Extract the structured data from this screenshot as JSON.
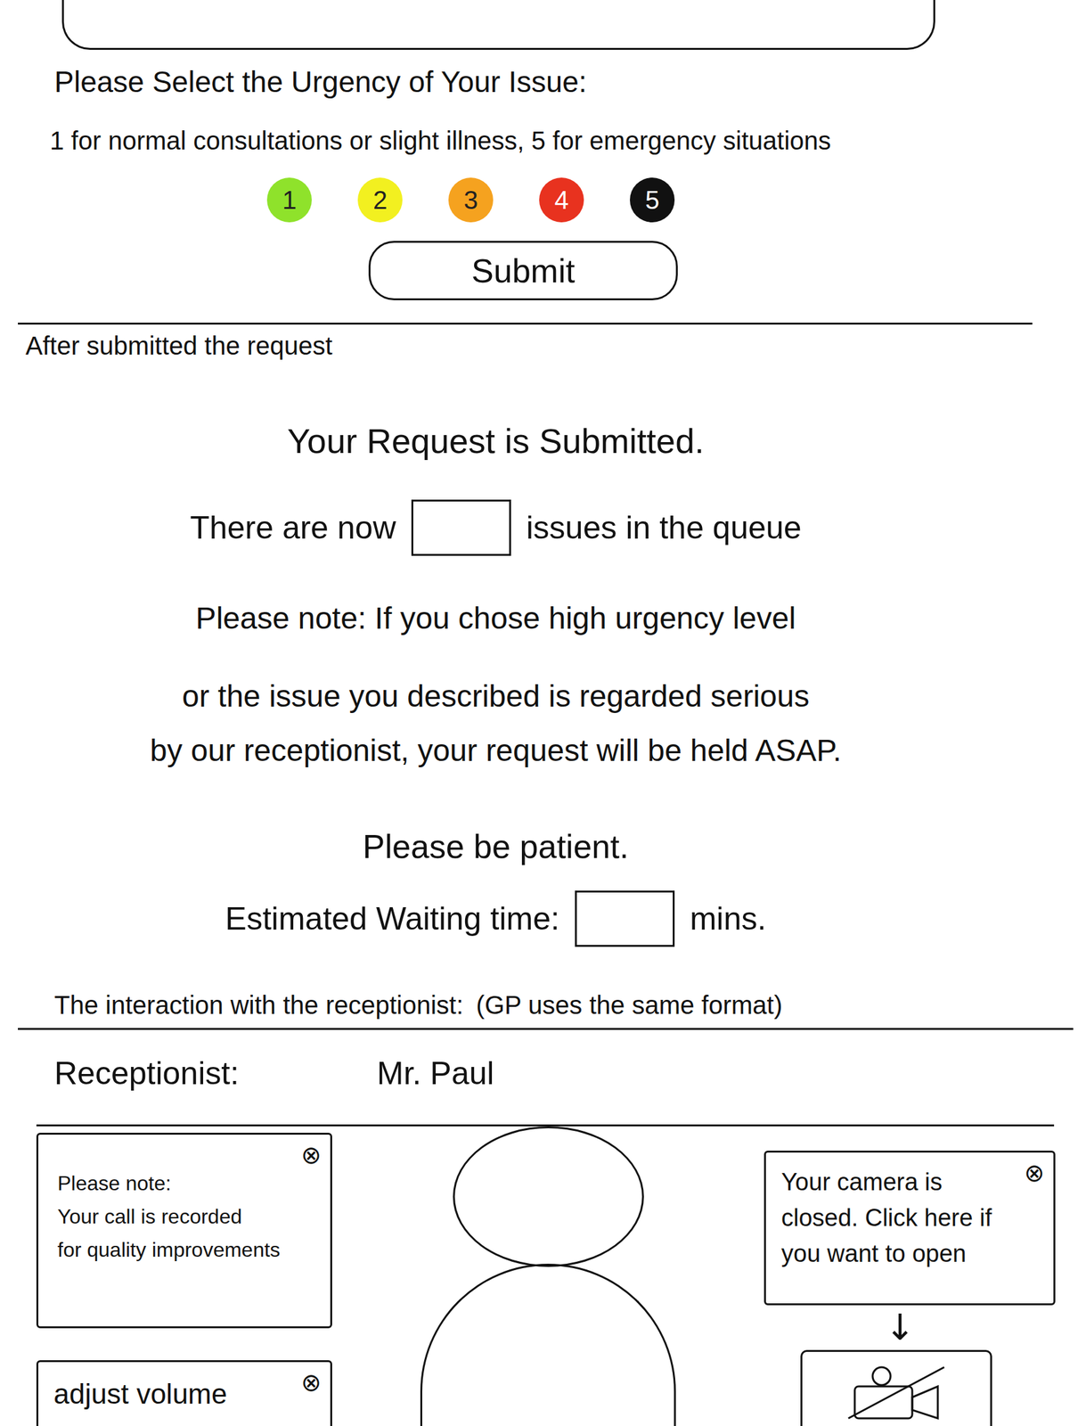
{
  "urgency": {
    "title": "Please Select the Urgency of Your Issue:",
    "hint": "1 for normal consultations or slight illness, 5 for emergency situations",
    "levels": [
      {
        "label": "1",
        "color": "#8fe22b"
      },
      {
        "label": "2",
        "color": "#f2f020"
      },
      {
        "label": "3",
        "color": "#f5a21f"
      },
      {
        "label": "4",
        "color": "#e8321f"
      },
      {
        "label": "5",
        "color": "#111111"
      }
    ],
    "submit": "Submit"
  },
  "section_label": "After submitted the request",
  "confirmation": {
    "title": "Your Request is Submitted.",
    "queue_prefix": "There are now",
    "queue_suffix": "issues in the queue",
    "note_lines": [
      "Please note: If you chose high urgency level",
      "or the issue you described is regarded serious",
      "by our receptionist, your request will be held ASAP."
    ],
    "patience": "Please be patient.",
    "wait_prefix": "Estimated Waiting time:",
    "wait_suffix": "mins."
  },
  "interaction": {
    "label": "The interaction with the receptionist:",
    "aside": "(GP uses the same format)"
  },
  "call": {
    "role": "Receptionist:",
    "name": "Mr. Paul",
    "notice": {
      "lines": [
        "Please note:",
        "Your call is recorded",
        "for quality improvements"
      ],
      "close": "⊗"
    },
    "volume": {
      "label": "adjust volume",
      "close": "⊗"
    },
    "camera_notice": {
      "text": "Your camera is closed. Click here if you want to open",
      "close": "⊗"
    },
    "arrow": "↓",
    "camera_on": false
  }
}
